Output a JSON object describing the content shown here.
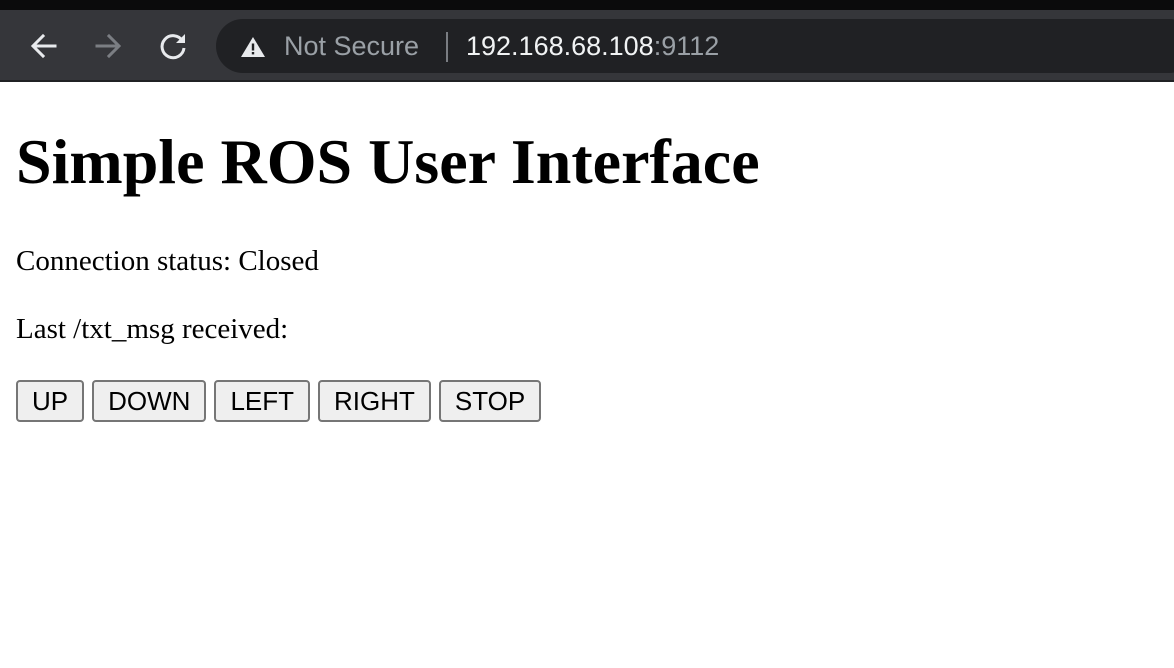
{
  "browser": {
    "security_label": "Not Secure",
    "url_host": "192.168.68.108",
    "url_port": ":9112",
    "icons": {
      "back": "arrow-left-icon",
      "forward": "arrow-right-icon",
      "reload": "reload-icon",
      "security": "warning-triangle-icon"
    },
    "colors": {
      "toolbar": "#35363a",
      "omnibox": "#202124",
      "host_text": "#f1f3f4",
      "dim_text": "#9aa0a6"
    }
  },
  "page": {
    "title": "Simple ROS User Interface",
    "connection_status": "Connection status: Closed",
    "last_message": "Last /txt_msg received:",
    "buttons": [
      {
        "label": "UP"
      },
      {
        "label": "DOWN"
      },
      {
        "label": "LEFT"
      },
      {
        "label": "RIGHT"
      },
      {
        "label": "STOP"
      }
    ]
  }
}
